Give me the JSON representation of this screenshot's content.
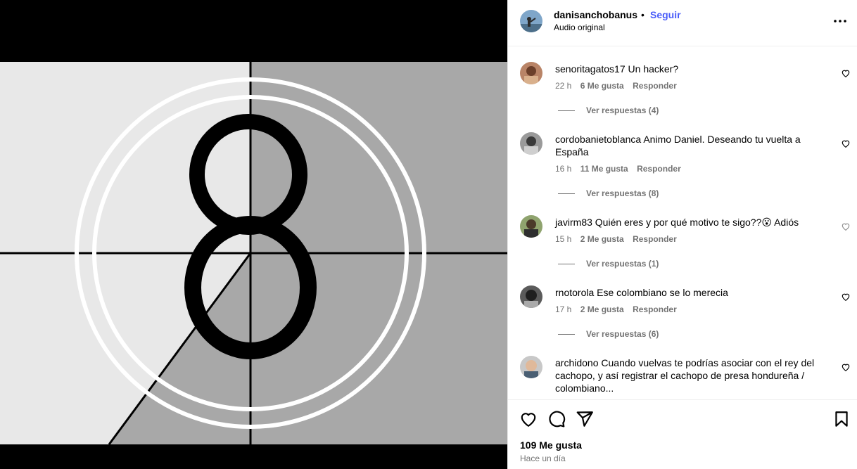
{
  "post": {
    "username": "danisanchobanus",
    "separator": "•",
    "follow_label": "Seguir",
    "audio": "Audio original",
    "media_number": "8"
  },
  "comments": [
    {
      "user": "senoritagatos17",
      "text": "Un hacker?",
      "time": "22 h",
      "likes": "6 Me gusta",
      "reply": "Responder",
      "replies": "Ver respuestas (4)"
    },
    {
      "user": "cordobanietoblanca",
      "text": "Animo Daniel. Deseando tu vuelta a España",
      "time": "16 h",
      "likes": "11 Me gusta",
      "reply": "Responder",
      "replies": "Ver respuestas (8)"
    },
    {
      "user": "javirm83",
      "text": "Quién eres y por qué motivo te sigo??😮 Adiós",
      "time": "15 h",
      "likes": "2 Me gusta",
      "reply": "Responder",
      "replies": "Ver respuestas (1)"
    },
    {
      "user": "rnotorola",
      "text": "Ese colombiano se lo merecia",
      "time": "17 h",
      "likes": "2 Me gusta",
      "reply": "Responder",
      "replies": "Ver respuestas (6)"
    },
    {
      "user": "archidono",
      "text": "Cuando vuelvas te podrías asociar con el rey del cachopo, y así registrar el cachopo de presa hondureña / colombiano...",
      "time": "",
      "likes": "",
      "reply": "",
      "replies": ""
    }
  ],
  "footer": {
    "likes_count": "109 Me gusta",
    "time_ago": "Hace un día"
  },
  "colors": {
    "follow": "#4a5df9",
    "muted": "#737373"
  },
  "icons": [
    "heart-icon",
    "comment-icon",
    "share-icon",
    "bookmark-icon",
    "more-options-icon"
  ]
}
